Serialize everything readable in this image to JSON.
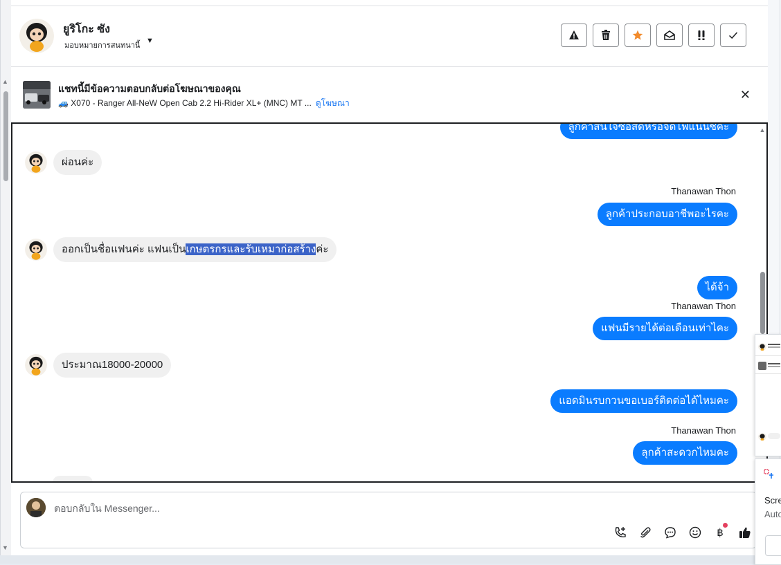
{
  "header": {
    "contact_name": "ยูริโกะ ซัง",
    "assign_label": "มอบหมายการสนทนานี้",
    "toolbar": [
      "spam",
      "delete",
      "star",
      "mark-unread",
      "important",
      "done"
    ]
  },
  "ad_notice": {
    "title": "แชทนี้มีข้อความตอบกลับต่อโฆษณาของคุณ",
    "ad_text": "🚙 X070 - Ranger All-NeW Open Cab 2.2 Hi-Rider XL+ (MNC) MT ...",
    "link": "ดูโฆษณา"
  },
  "chat": {
    "partial_top": "ลูกค้าสนใจซื้อสดหรือจัดไฟแนนซ์คะ",
    "msg1": "ผ่อนค่ะ",
    "sender1": "Thanawan Thon",
    "out1": "ลูกค้าประกอบอาชีพอะไรคะ",
    "msg2_before": "ออกเป็นชื่อแฟนค่ะ  แฟนเป็น",
    "msg2_selected": "เกษตรกรและรับเหมาก่อสร้าง",
    "msg2_after": "ค่ะ",
    "out2": "ได้จ้า",
    "sender2": "Thanawan Thon",
    "out3": "แฟนมีรายได้ต่อเดือนเท่าไคะ",
    "msg3": "ประมาณ18000-20000",
    "out4": "แอดมินรบกวนขอเบอร์ติดต่อได้ไหมคะ",
    "sender3": "Thanawan Thon",
    "out5": "ลุกค้าสะดวกไหมคะ"
  },
  "composer": {
    "placeholder": "ตอบกลับใน Messenger...",
    "icons": [
      "call-add-icon",
      "attachment-icon",
      "saved-reply-icon",
      "emoji-icon",
      "payment-icon",
      "like-icon"
    ]
  },
  "side_popup": {
    "line1": "Scre",
    "line2": "Auto"
  },
  "colors": {
    "outgoing_bubble": "#0a7cff",
    "incoming_bubble": "#f0f0f0",
    "selection": "#3c64c8",
    "star": "#f28b2c"
  }
}
